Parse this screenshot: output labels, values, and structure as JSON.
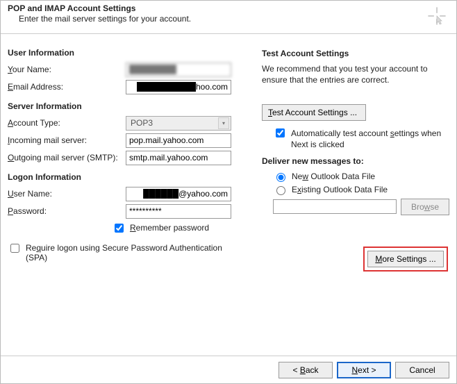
{
  "header": {
    "title": "POP and IMAP Account Settings",
    "subtitle": "Enter the mail server settings for your account."
  },
  "left": {
    "user_info_head": "User Information",
    "your_name_label_pre": "Y",
    "your_name_label_rest": "our Name:",
    "your_name_value": "████████",
    "email_label_pre": "E",
    "email_label_rest": "mail Address:",
    "email_value": "██████████hoo.com",
    "server_info_head": "Server Information",
    "account_type_label_pre": "A",
    "account_type_label_rest": "ccount Type:",
    "account_type_value": "POP3",
    "incoming_label_pre": "I",
    "incoming_label_rest": "ncoming mail server:",
    "incoming_value": "pop.mail.yahoo.com",
    "outgoing_label_pre": "O",
    "outgoing_label_rest": "utgoing mail server (SMTP):",
    "outgoing_value": "smtp.mail.yahoo.com",
    "logon_head": "Logon Information",
    "username_label_pre": "U",
    "username_label_rest": "ser Name:",
    "username_value": "██████@yahoo.com",
    "password_label_pre": "P",
    "password_label_rest": "assword:",
    "password_value": "**********",
    "remember_label_pre": "R",
    "remember_label_rest": "emember password",
    "spa_label_pre": "Re",
    "spa_label_u": "q",
    "spa_label_rest": "uire logon using Secure Password Authentication (SPA)"
  },
  "right": {
    "test_head": "Test Account Settings",
    "test_desc": "We recommend that you test your account to ensure that the entries are correct.",
    "test_btn_pre": "T",
    "test_btn_rest": "est Account Settings ...",
    "auto_test_pre": "Automatically test account ",
    "auto_test_u": "s",
    "auto_test_rest": "ettings when Next is clicked",
    "deliver_head": "Deliver new messages to:",
    "radio_new_pre": "Ne",
    "radio_new_u": "w",
    "radio_new_rest": " Outlook Data File",
    "radio_existing_pre": "E",
    "radio_existing_u": "x",
    "radio_existing_rest": "isting Outlook Data File",
    "browse_pre": "Bro",
    "browse_u": "w",
    "browse_rest": "se",
    "more_pre": "M",
    "more_rest": "ore Settings ..."
  },
  "footer": {
    "back_lt": "< ",
    "back_u": "B",
    "back_rest": "ack",
    "next_u": "N",
    "next_rest": "ext >",
    "cancel": "Cancel"
  }
}
